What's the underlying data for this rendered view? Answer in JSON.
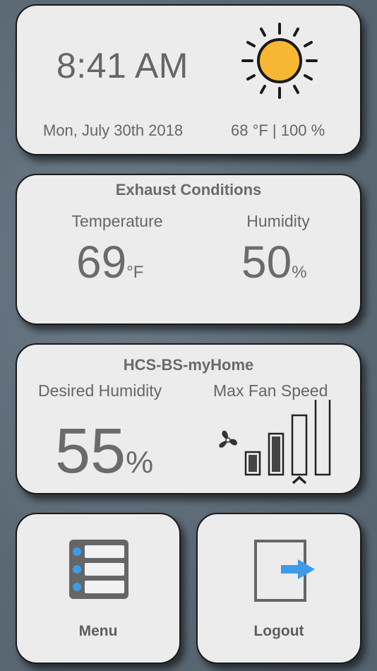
{
  "clock": {
    "time": "8:41 AM",
    "date": "Mon, July 30th 2018",
    "weather": "68 °F | 100 %",
    "weather_icon": "sun-icon"
  },
  "exhaust": {
    "title": "Exhaust Conditions",
    "temperature_label": "Temperature",
    "temperature_value": "69",
    "temperature_unit": "°F",
    "humidity_label": "Humidity",
    "humidity_value": "50",
    "humidity_unit": "%"
  },
  "controller": {
    "name": "HCS-BS-myHome",
    "desired_humidity_label": "Desired Humidity",
    "desired_humidity_value": "55",
    "desired_humidity_unit": "%",
    "max_fan_speed_label": "Max Fan Speed",
    "fan_speed_levels": 4,
    "fan_speed_selected": 3,
    "fan_icon": "fan-icon"
  },
  "tiles": {
    "menu_label": "Menu",
    "menu_icon": "list-menu-icon",
    "logout_label": "Logout",
    "logout_icon": "logout-door-icon"
  },
  "colors": {
    "background": "#5f6e7a",
    "card": "#ececec",
    "sun": "#f7b733",
    "accent_blue": "#3d9be9",
    "text": "#666666"
  }
}
